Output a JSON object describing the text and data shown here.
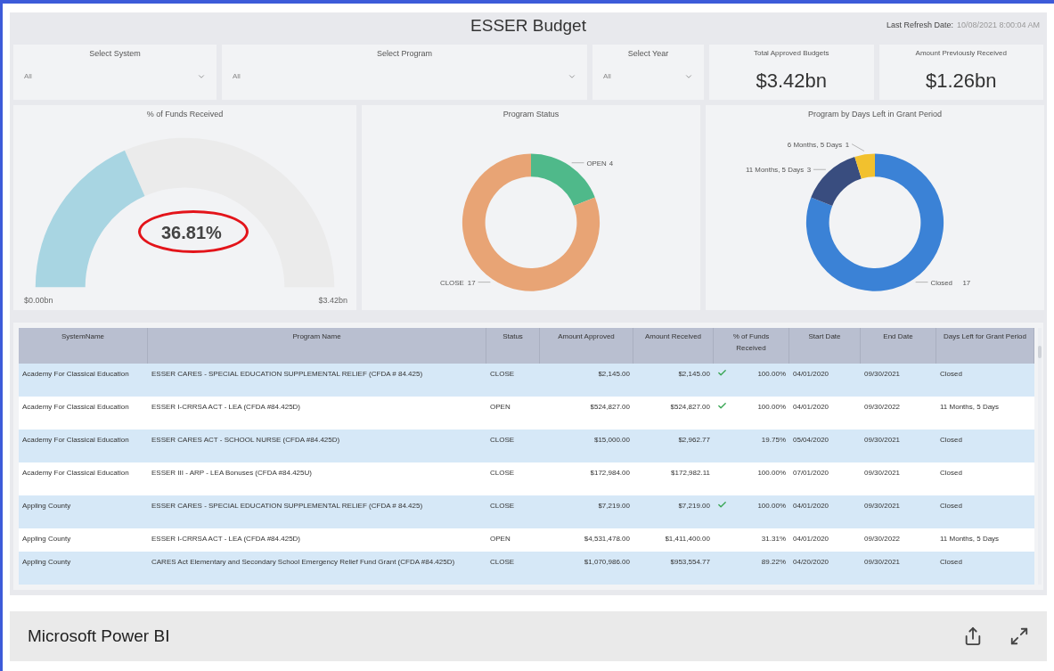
{
  "report": {
    "title": "ESSER Budget",
    "refresh_label": "Last Refresh Date:",
    "refresh_value": "10/08/2021 8:00:04 AM"
  },
  "slicers": [
    {
      "label": "Select System",
      "value": "All"
    },
    {
      "label": "Select Program",
      "value": "All"
    },
    {
      "label": "Select Year",
      "value": "All"
    }
  ],
  "cards": [
    {
      "label": "Total Approved Budgets",
      "value": "$3.42bn"
    },
    {
      "label": "Amount Previously Received",
      "value": "$1.26bn"
    }
  ],
  "gauge": {
    "title": "% of Funds Received",
    "value": "36.81%",
    "level": 0.3681,
    "min_label": "$0.00bn",
    "max_label": "$3.42bn"
  },
  "donuts": [
    {
      "title": "Program Status",
      "kind": "donut",
      "slices": [
        {
          "label": "OPEN",
          "value": "4",
          "color": "#4fb98a"
        },
        {
          "label": "CLOSE",
          "value": "17",
          "color": "#e8a475"
        }
      ]
    },
    {
      "title": "Program by Days Left in Grant Period",
      "kind": "donut",
      "slices": [
        {
          "label": "Closed",
          "value": "17",
          "color": "#3b82d6"
        },
        {
          "label": "11 Months, 5 Days",
          "value": "3",
          "color": "#394d7f"
        },
        {
          "label": "6 Months, 5 Days",
          "value": "1",
          "color": "#f2c12e"
        }
      ]
    }
  ],
  "table": {
    "columns": [
      "SystemName",
      "Program Name",
      "Status",
      "Amount Approved",
      "Amount Received",
      "% of Funds Received",
      "Start Date",
      "End Date",
      "Days Left for Grant Period"
    ],
    "rows": [
      {
        "system": "Academy For Classical Education",
        "program": "ESSER CARES - SPECIAL EDUCATION SUPPLEMENTAL RELIEF (CFDA # 84.425)",
        "status": "CLOSE",
        "approved": "$2,145.00",
        "received": "$2,145.00",
        "check": true,
        "pct": "100.00%",
        "start": "04/01/2020",
        "end": "09/30/2021",
        "days": "Closed"
      },
      {
        "system": "Academy For Classical Education",
        "program": "ESSER I-CRRSA ACT - LEA (CFDA #84.425D)",
        "status": "OPEN",
        "approved": "$524,827.00",
        "received": "$524,827.00",
        "check": true,
        "pct": "100.00%",
        "start": "04/01/2020",
        "end": "09/30/2022",
        "days": "11 Months, 5 Days"
      },
      {
        "system": "Academy For Classical Education",
        "program": "ESSER CARES ACT - SCHOOL NURSE (CFDA #84.425D)",
        "status": "CLOSE",
        "approved": "$15,000.00",
        "received": "$2,962.77",
        "check": false,
        "pct": "19.75%",
        "start": "05/04/2020",
        "end": "09/30/2021",
        "days": "Closed"
      },
      {
        "system": "Academy For Classical Education",
        "program": "ESSER III - ARP - LEA Bonuses (CFDA #84.425U)",
        "status": "CLOSE",
        "approved": "$172,984.00",
        "received": "$172,982.11",
        "check": false,
        "pct": "100.00%",
        "start": "07/01/2020",
        "end": "09/30/2021",
        "days": "Closed"
      },
      {
        "system": "Appling County",
        "program": "ESSER CARES - SPECIAL EDUCATION SUPPLEMENTAL RELIEF (CFDA # 84.425)",
        "status": "CLOSE",
        "approved": "$7,219.00",
        "received": "$7,219.00",
        "check": true,
        "pct": "100.00%",
        "start": "04/01/2020",
        "end": "09/30/2021",
        "days": "Closed"
      },
      {
        "system": "Appling County",
        "program": "ESSER I-CRRSA ACT - LEA (CFDA #84.425D)",
        "status": "OPEN",
        "approved": "$4,531,478.00",
        "received": "$1,411,400.00",
        "check": false,
        "pct": "31.31%",
        "start": "04/01/2020",
        "end": "09/30/2022",
        "days": "11 Months, 5 Days"
      },
      {
        "system": "Appling County",
        "program": "CARES Act Elementary and Secondary School Emergency Relief Fund Grant (CFDA #84.425D)",
        "status": "CLOSE",
        "approved": "$1,070,986.00",
        "received": "$953,554.77",
        "check": false,
        "pct": "89.22%",
        "start": "04/20/2020",
        "end": "09/30/2021",
        "days": "Closed"
      }
    ]
  },
  "footer": {
    "brand": "Microsoft Power BI"
  }
}
